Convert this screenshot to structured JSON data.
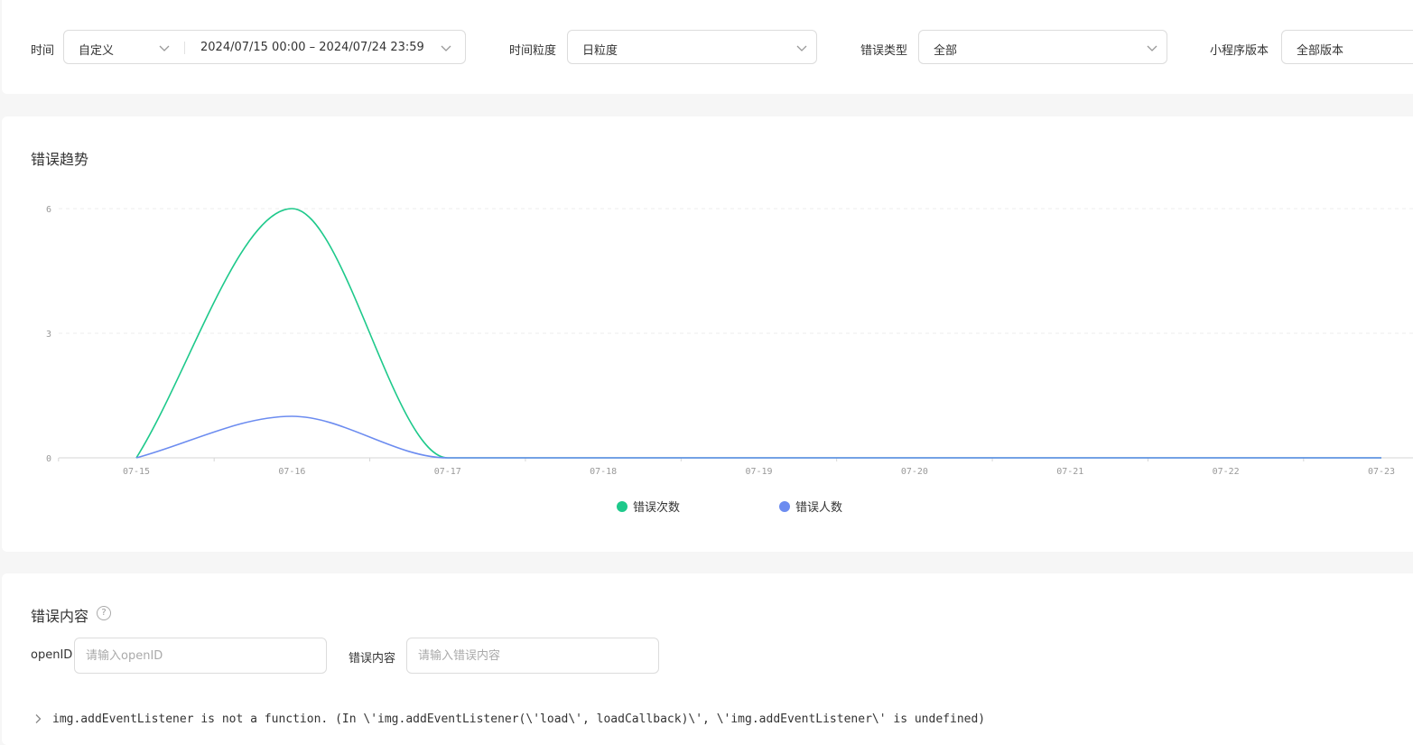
{
  "filters": {
    "time_label": "时间",
    "time_mode": "自定义",
    "time_range": "2024/07/15 00:00 – 2024/07/24 23:59",
    "granularity_label": "时间粒度",
    "granularity_value": "日粒度",
    "error_type_label": "错误类型",
    "error_type_value": "全部",
    "version_label": "小程序版本",
    "version_value": "全部版本"
  },
  "trend": {
    "title": "错误趋势",
    "legend": [
      {
        "label": "错误次数",
        "color": "#1ec98b"
      },
      {
        "label": "错误人数",
        "color": "#6c8cf0"
      }
    ]
  },
  "chart_data": {
    "type": "line",
    "title": "错误趋势",
    "categories": [
      "07-15",
      "07-16",
      "07-17",
      "07-18",
      "07-19",
      "07-20",
      "07-21",
      "07-22",
      "07-23"
    ],
    "series": [
      {
        "name": "错误次数",
        "color": "#1ec98b",
        "values": [
          0,
          6,
          0,
          0,
          0,
          0,
          0,
          0,
          0
        ]
      },
      {
        "name": "错误人数",
        "color": "#6c8cf0",
        "values": [
          0,
          1,
          0,
          0,
          0,
          0,
          0,
          0,
          0
        ]
      }
    ],
    "yticks": [
      0,
      3,
      6
    ],
    "ylim": [
      0,
      6
    ],
    "smooth": true,
    "grid": "horizontal-dashed",
    "legend_position": "bottom-center"
  },
  "content": {
    "title": "错误内容",
    "help_icon": "question-circle-icon",
    "openid_label": "openID",
    "openid_placeholder": "请输入openID",
    "error_label": "错误内容",
    "error_placeholder": "请输入错误内容",
    "rows": [
      {
        "message": "img.addEventListener is not a function. (In \\'img.addEventListener(\\'load\\', loadCallback)\\', \\'img.addEventListener\\' is undefined)"
      }
    ]
  }
}
